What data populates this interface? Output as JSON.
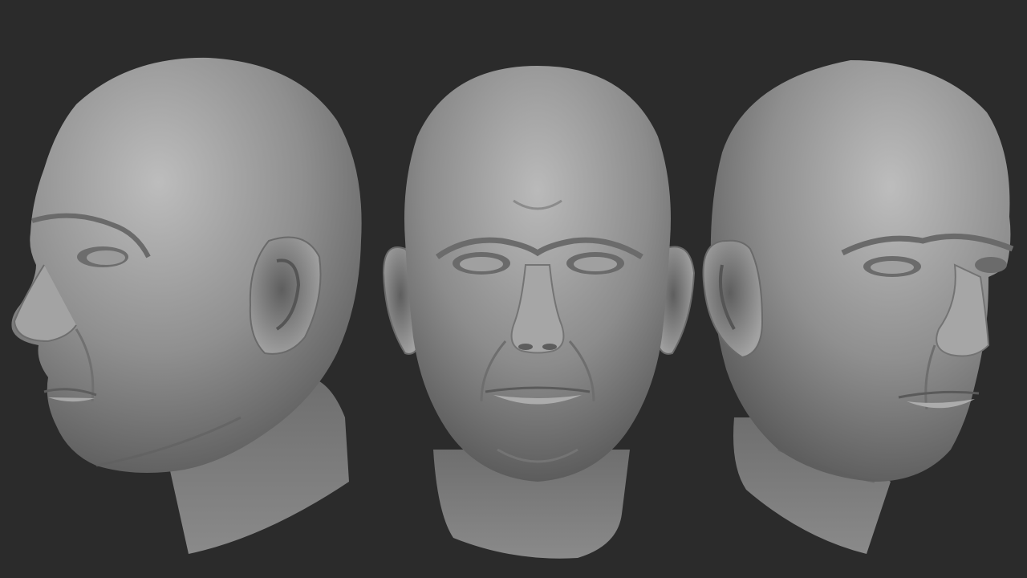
{
  "scene": {
    "background": "#2b2b2b",
    "clay_highlight": "#b8b8b8",
    "clay_mid": "#8e8e8e",
    "clay_shadow": "#4a4a4a",
    "render_views": [
      {
        "view": "left-three-quarter"
      },
      {
        "view": "front"
      },
      {
        "view": "right-three-quarter"
      }
    ]
  }
}
